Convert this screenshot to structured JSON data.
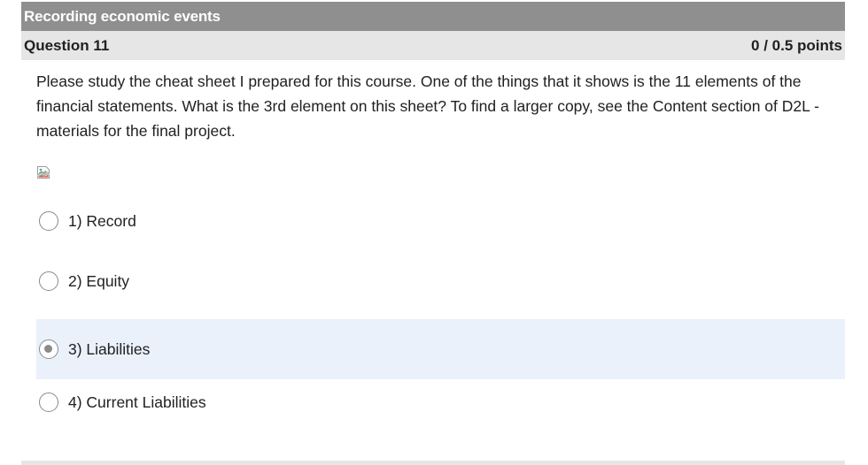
{
  "section": {
    "title": "Recording economic events"
  },
  "question": {
    "number_label": "Question 11",
    "points_label": "0 / 0.5 points",
    "text": "Please study the cheat sheet I prepared for this course. One of the things that it shows is the 11 elements of the financial statements. What is the 3rd element on this sheet? To find a larger copy, see the Content section of D2L - materials for the final project."
  },
  "options": [
    {
      "label": "1)  Record",
      "selected": false
    },
    {
      "label": "2)  Equity",
      "selected": false
    },
    {
      "label": "3)  Liabilities",
      "selected": true
    },
    {
      "label": "4)  Current Liabilities",
      "selected": false
    }
  ],
  "icons": {
    "broken_image": "broken-image-icon",
    "radio": "radio-button-icon"
  },
  "colors": {
    "section_header_bg": "#8f8f8f",
    "question_header_bg": "#e6e6e6",
    "selected_option_bg": "#eaf1fb"
  }
}
